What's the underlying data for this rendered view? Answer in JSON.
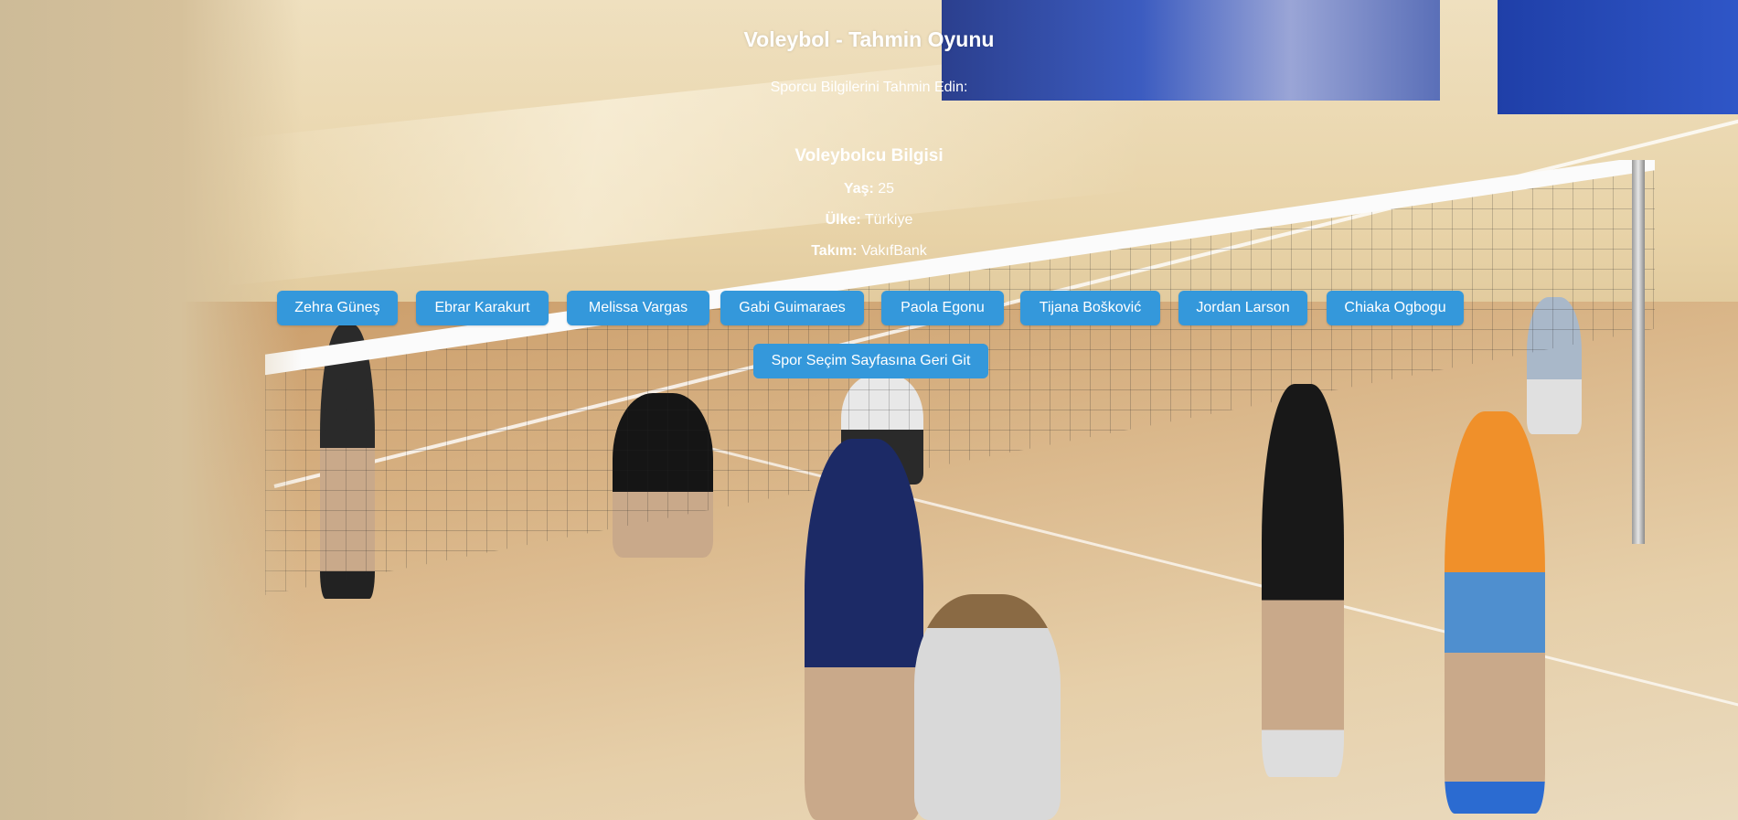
{
  "game": {
    "title": "Voleybol - Tahmin Oyunu",
    "subtitle": "Sporcu Bilgilerini Tahmin Edin:"
  },
  "athlete_info": {
    "heading": "Voleybolcu Bilgisi",
    "age_label": "Yaş:",
    "age_value": "25",
    "country_label": "Ülke:",
    "country_value": "Türkiye",
    "team_label": "Takım:",
    "team_value": "VakıfBank"
  },
  "choices": [
    {
      "label": "Zehra Güneş"
    },
    {
      "label": "Ebrar Karakurt"
    },
    {
      "label": "Melissa Vargas"
    },
    {
      "label": "Gabi Guimaraes"
    },
    {
      "label": "Paola Egonu"
    },
    {
      "label": "Tijana Bošković"
    },
    {
      "label": "Jordan Larson"
    },
    {
      "label": "Chiaka Ogbogu"
    }
  ],
  "navigation": {
    "back_label": "Spor Seçim Sayfasına Geri Git"
  },
  "colors": {
    "button_bg": "#3498db",
    "text": "#ffffff"
  }
}
